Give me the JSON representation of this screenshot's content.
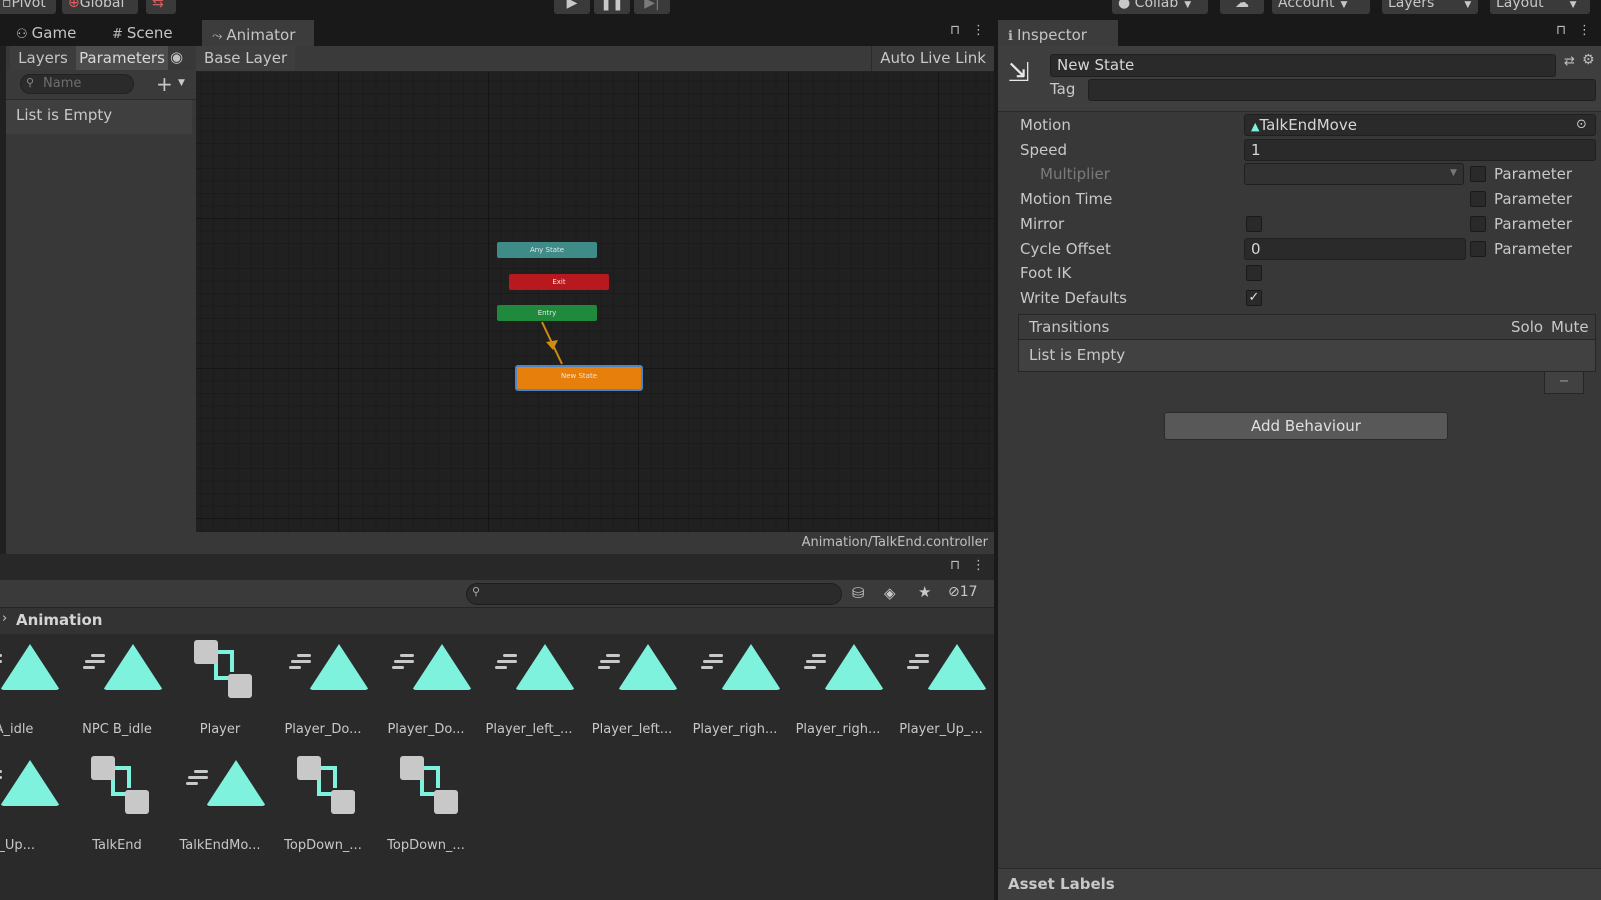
{
  "toolbar": {
    "pivot": "Pivot",
    "global": "Global",
    "collab": "Collab",
    "account": "Account",
    "layers": "Layers",
    "layout": "Layout"
  },
  "animator_window": {
    "tabs": [
      "Game",
      "Scene",
      "Animator"
    ],
    "subtabs": {
      "layers": "Layers",
      "parameters": "Parameters"
    },
    "breadcrumb": "Base Layer",
    "auto_live_link": "Auto Live Link",
    "search_placeholder": "Name",
    "params_empty": "List is Empty",
    "footer_path": "Animation/TalkEnd.controller",
    "nodes": {
      "any_state": "Any State",
      "exit": "Exit",
      "entry": "Entry",
      "new_state": "New State"
    }
  },
  "project_window": {
    "folder": "Animation",
    "hidden_count": "17",
    "assets_row1": [
      {
        "label": "A_idle",
        "type": "anim"
      },
      {
        "label": "NPC B_idle",
        "type": "anim"
      },
      {
        "label": "Player",
        "type": "controller"
      },
      {
        "label": "Player_Do...",
        "type": "anim"
      },
      {
        "label": "Player_Do...",
        "type": "anim"
      },
      {
        "label": "Player_left_...",
        "type": "anim"
      },
      {
        "label": "Player_left...",
        "type": "anim"
      },
      {
        "label": "Player_righ...",
        "type": "anim"
      },
      {
        "label": "Player_righ...",
        "type": "anim"
      },
      {
        "label": "Player_Up_...",
        "type": "anim"
      }
    ],
    "assets_row2": [
      {
        "label": "r_Up...",
        "type": "anim"
      },
      {
        "label": "TalkEnd",
        "type": "controller"
      },
      {
        "label": "TalkEndMo...",
        "type": "anim"
      },
      {
        "label": "TopDown_...",
        "type": "controller"
      },
      {
        "label": "TopDown_...",
        "type": "controller"
      }
    ]
  },
  "inspector": {
    "tab": "Inspector",
    "state_name": "New State",
    "tag_label": "Tag",
    "tag_value": "",
    "motion_label": "Motion",
    "motion_value": "TalkEndMove",
    "speed_label": "Speed",
    "speed_value": "1",
    "multiplier_label": "Multiplier",
    "motion_time_label": "Motion Time",
    "mirror_label": "Mirror",
    "cycle_offset_label": "Cycle Offset",
    "cycle_offset_value": "0",
    "foot_ik_label": "Foot IK",
    "write_defaults_label": "Write Defaults",
    "write_defaults_checked": true,
    "parameter_label": "Parameter",
    "transitions_label": "Transitions",
    "solo_label": "Solo",
    "mute_label": "Mute",
    "transitions_empty": "List is Empty",
    "minus": "−",
    "add_behaviour": "Add Behaviour",
    "asset_labels": "Asset Labels"
  },
  "colors": {
    "any_state": "#3e8b88",
    "exit": "#b8191f",
    "entry": "#1f8a3c",
    "new_state": "#e77f0c",
    "anim_icon": "#7ef2dc"
  }
}
